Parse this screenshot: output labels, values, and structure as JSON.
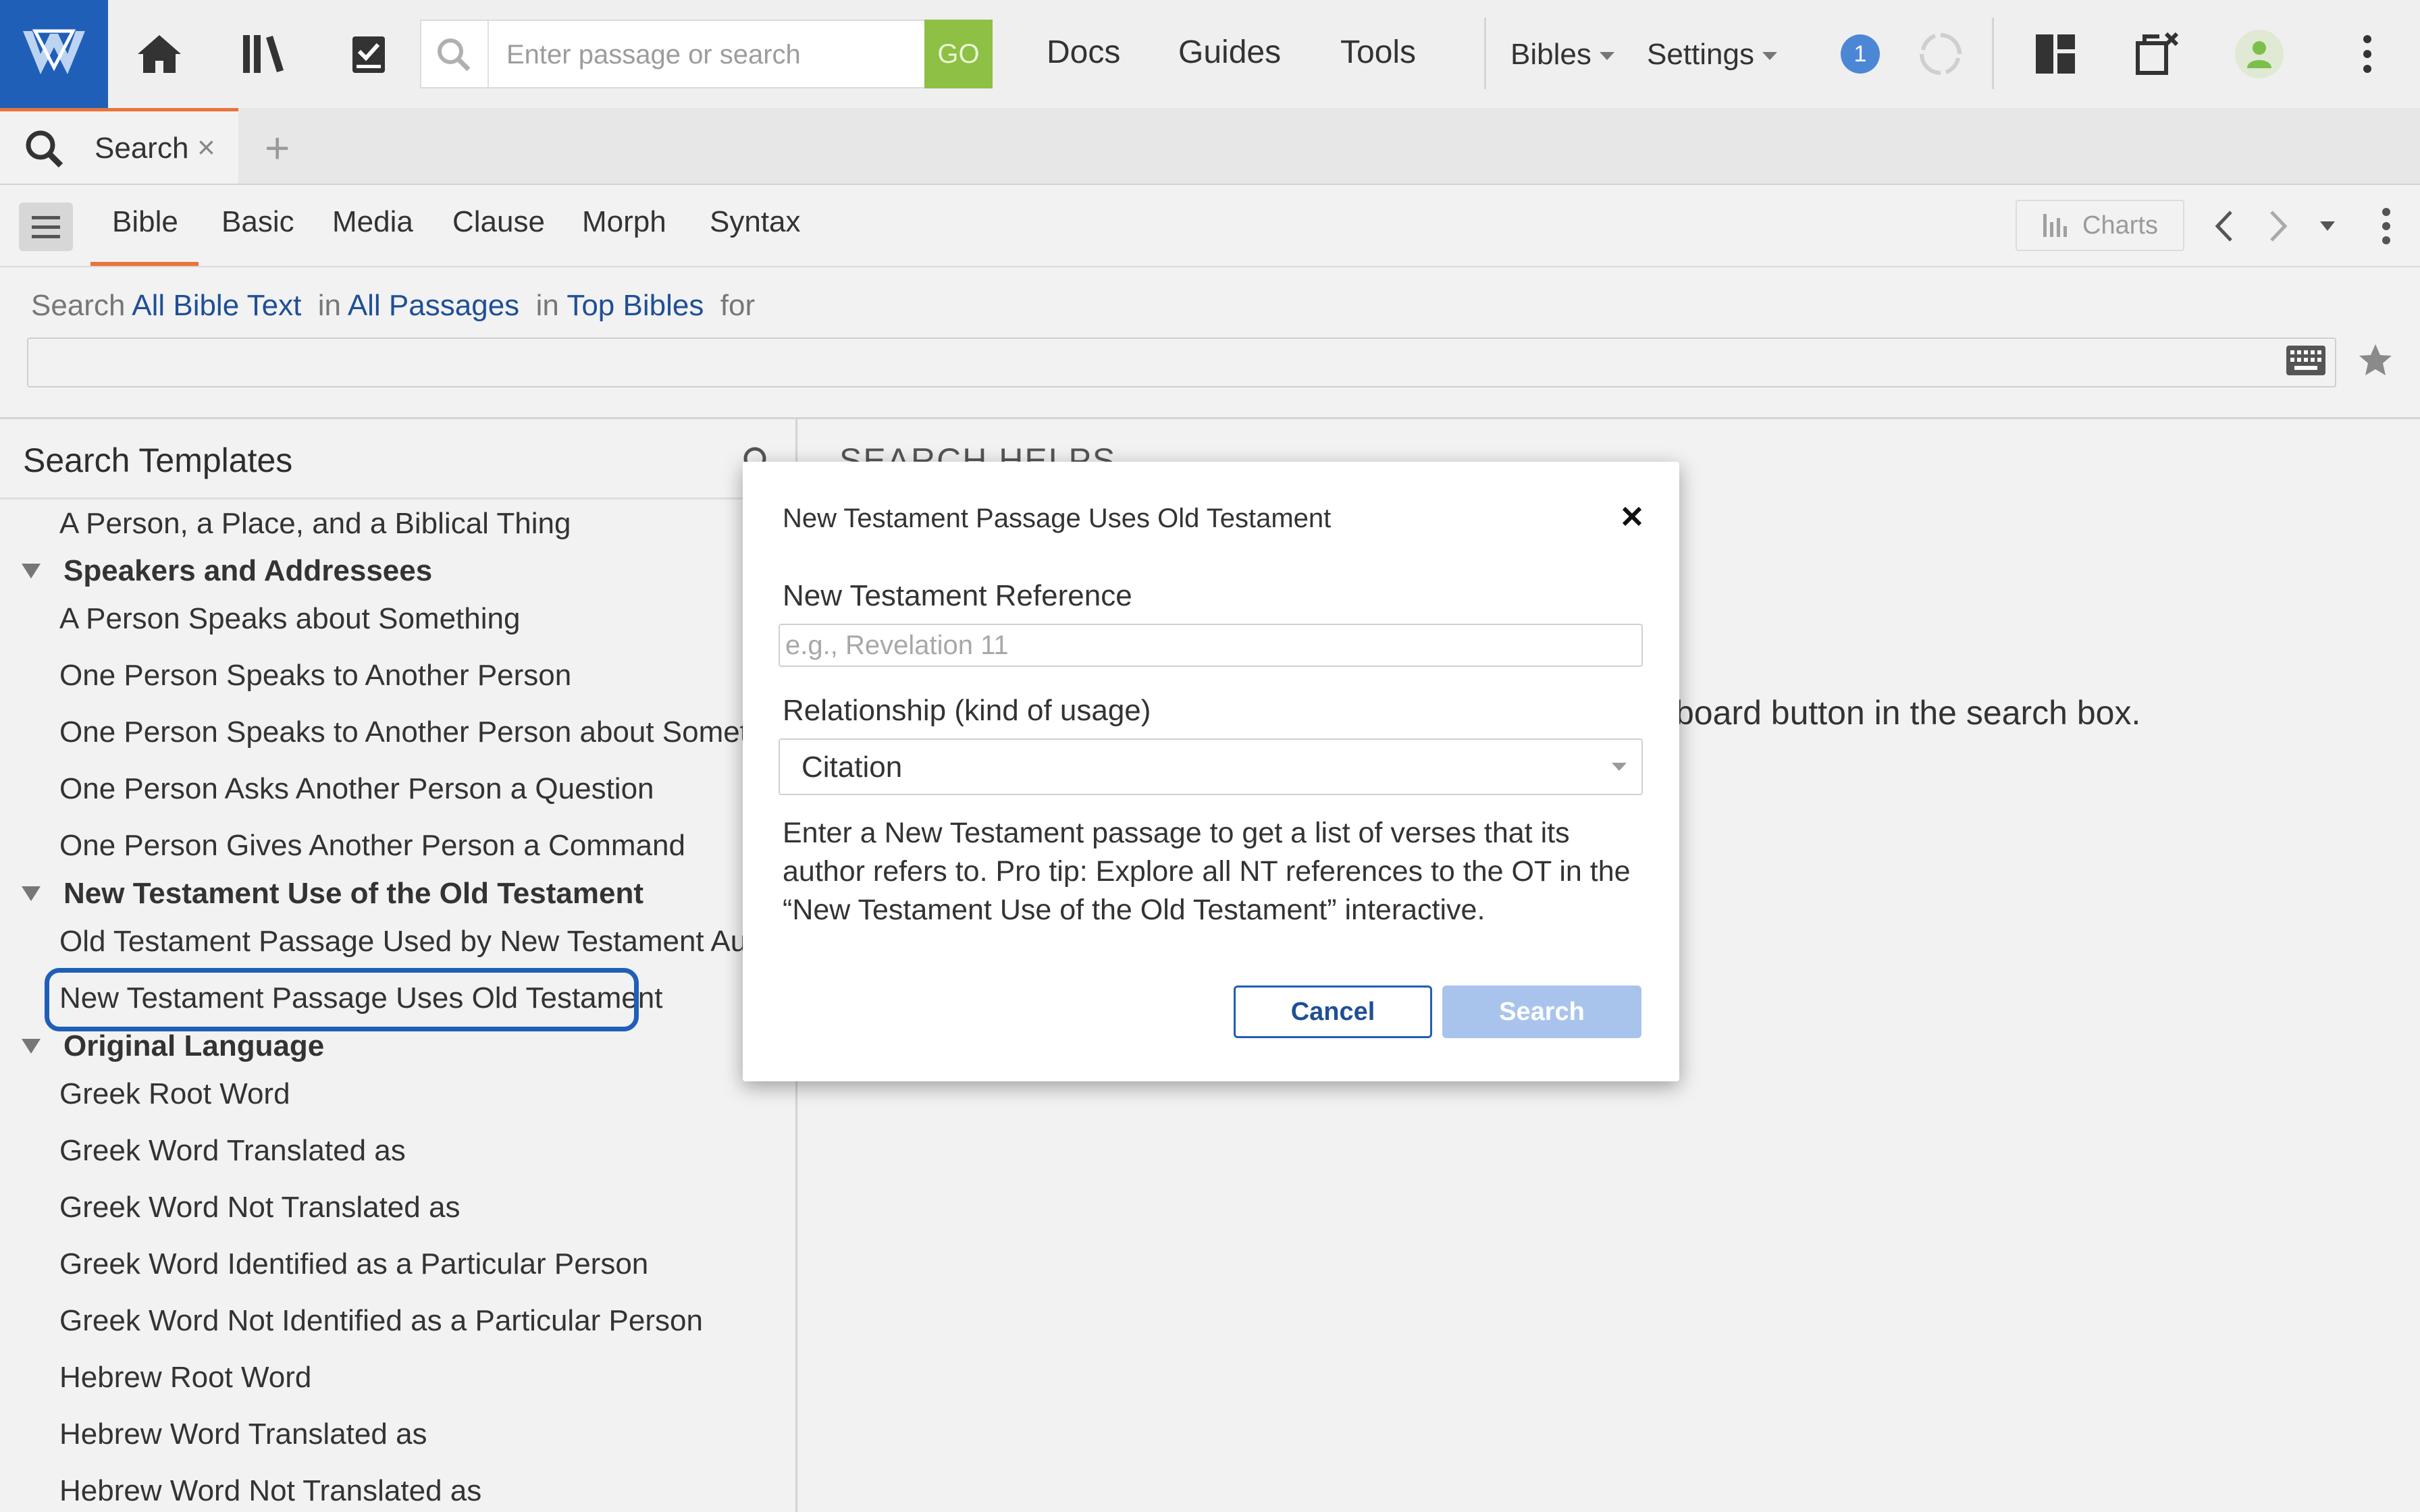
{
  "toolbar": {
    "search_placeholder": "Enter passage or search",
    "go_label": "GO",
    "links": [
      "Docs",
      "Guides",
      "Tools"
    ],
    "bibles_label": "Bibles",
    "settings_label": "Settings",
    "notification_count": "1"
  },
  "tabs": [
    {
      "label": "Search"
    }
  ],
  "search_types": [
    "Bible",
    "Basic",
    "Media",
    "Clause",
    "Morph",
    "Syntax"
  ],
  "charts_label": "Charts",
  "scope": {
    "search_word": "Search",
    "text_scope": "All Bible Text",
    "in1": "in",
    "passages": "All Passages",
    "in2": "in",
    "bibles": "Top Bibles",
    "for_word": "for"
  },
  "left_panel": {
    "title": "Search Templates",
    "items": [
      {
        "type": "item",
        "label": "A Person, a Place, and a Biblical Thing"
      },
      {
        "type": "category",
        "label": "Speakers and Addressees"
      },
      {
        "type": "item",
        "label": "A Person Speaks about Something"
      },
      {
        "type": "item",
        "label": "One Person Speaks to Another Person"
      },
      {
        "type": "item",
        "label": "One Person Speaks to Another Person about Somethin"
      },
      {
        "type": "item",
        "label": "One Person Asks Another Person a Question"
      },
      {
        "type": "item",
        "label": "One Person Gives Another Person a Command"
      },
      {
        "type": "category",
        "label": "New Testament Use of the Old Testament"
      },
      {
        "type": "item",
        "label": "Old Testament Passage Used by New Testament Autho"
      },
      {
        "type": "item",
        "label": "New Testament Passage Uses Old Testament"
      },
      {
        "type": "category",
        "label": "Original Language"
      },
      {
        "type": "item",
        "label": "Greek Root Word"
      },
      {
        "type": "item",
        "label": "Greek Word Translated as"
      },
      {
        "type": "item",
        "label": "Greek Word Not Translated as"
      },
      {
        "type": "item",
        "label": "Greek Word Identified as a Particular Person"
      },
      {
        "type": "item",
        "label": "Greek Word Not Identified as a Particular Person"
      },
      {
        "type": "item",
        "label": "Hebrew Root Word"
      },
      {
        "type": "item",
        "label": "Hebrew Word Translated as"
      },
      {
        "type": "item",
        "label": "Hebrew Word Not Translated as"
      }
    ]
  },
  "right_panel": {
    "heading": "SEARCH HELPS",
    "partial_text": "board button in the search box."
  },
  "dialog": {
    "title": "New Testament Passage Uses Old Testament",
    "ref_label": "New Testament Reference",
    "ref_placeholder": "e.g., Revelation 11",
    "rel_label": "Relationship (kind of usage)",
    "rel_value": "Citation",
    "description": "Enter a New Testament passage to get a list of verses that its author refers to. Pro tip: Explore all NT references to the OT in the “New Testament Use of the Old Testament” interactive.",
    "cancel_label": "Cancel",
    "search_label": "Search"
  },
  "colors": {
    "brand_blue": "#1f5fb7",
    "go_green": "#8dc044",
    "tab_accent": "#e8743b",
    "link_blue": "#1f4f96"
  }
}
